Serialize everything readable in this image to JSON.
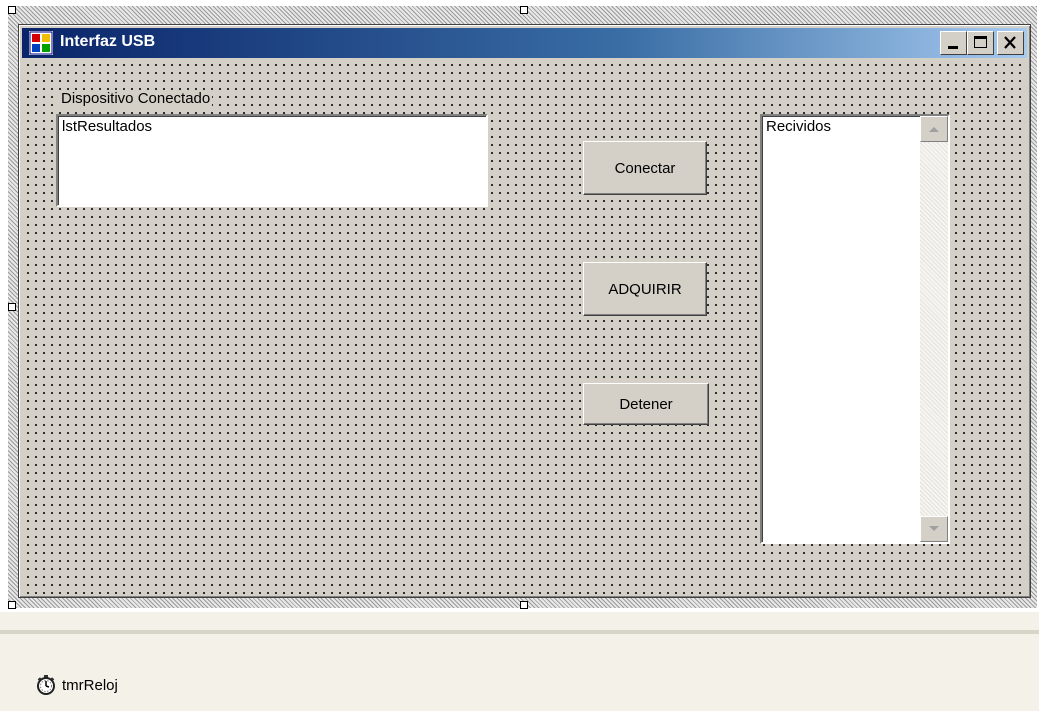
{
  "window": {
    "title": "Interfaz USB",
    "caption_buttons": [
      "minimize",
      "maximize",
      "close"
    ]
  },
  "form": {
    "device_label": "Dispositivo Conectado",
    "results_list": {
      "items": [
        "lstResultados"
      ]
    },
    "received_list": {
      "items": [
        "Recividos"
      ]
    },
    "buttons": {
      "connect": "Conectar",
      "acquire": "ADQUIRIR",
      "stop": "Detener"
    }
  },
  "component_tray": {
    "items": [
      {
        "label": "tmrReloj",
        "icon": "stopwatch-icon"
      }
    ]
  },
  "colors": {
    "title_bar_start": "#0a246a",
    "title_bar_end": "#a6caf0",
    "form_background": "#d4d0c8",
    "tray_background": "#f4f1e9"
  }
}
